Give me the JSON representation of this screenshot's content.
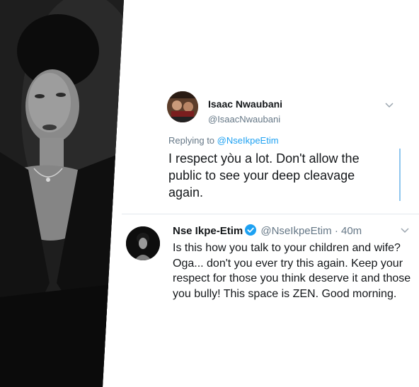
{
  "tweet_reply": {
    "author_name": "Isaac Nwaubani",
    "author_handle": "@IsaacNwaubani",
    "replying_to_prefix": "Replying to ",
    "replying_to_handle": "@NseIkpeEtim",
    "text": "I respect yòu a lot.  Don't allow the public to see your deep cleavage again."
  },
  "tweet_response": {
    "author_name": "Nse Ikpe-Etim",
    "author_handle": "@NseIkpeEtim",
    "separator": "·",
    "time": "40m",
    "text": "Is this how you talk to your children and wife? Oga... don't you ever try this again. Keep your respect for those you think deserve it and those you bully! This space is ZEN. Good morning."
  },
  "icons": {
    "verified": "verified-badge-icon",
    "menu": "chevron-down-icon"
  },
  "colors": {
    "link": "#1da1f2",
    "secondary_text": "#657786",
    "primary_text": "#14171a"
  }
}
